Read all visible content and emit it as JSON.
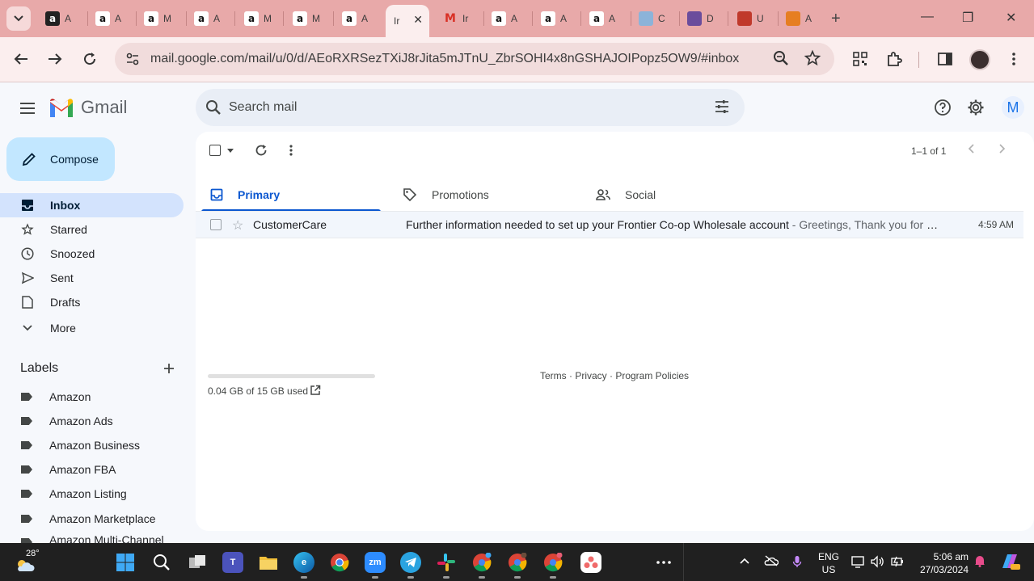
{
  "browser": {
    "tabs": [
      {
        "favicon": "amazon-dark-icon",
        "letter": "a",
        "title": "A"
      },
      {
        "favicon": "amazon-icon",
        "letter": "a",
        "title": "A"
      },
      {
        "favicon": "amazon-icon",
        "letter": "a",
        "title": "M"
      },
      {
        "favicon": "amazon-icon",
        "letter": "a",
        "title": "A"
      },
      {
        "favicon": "amazon-icon",
        "letter": "a",
        "title": "M"
      },
      {
        "favicon": "amazon-icon",
        "letter": "a",
        "title": "M"
      },
      {
        "favicon": "amazon-icon",
        "letter": "a",
        "title": "A"
      },
      {
        "favicon": "gmail-active",
        "letter": "",
        "title": "Ir"
      },
      {
        "favicon": "gmail-icon",
        "letter": "M",
        "title": "Ir"
      },
      {
        "favicon": "amazon-icon",
        "letter": "a",
        "title": "A"
      },
      {
        "favicon": "amazon-icon",
        "letter": "a",
        "title": "A"
      },
      {
        "favicon": "amazon-icon",
        "letter": "a",
        "title": "A"
      },
      {
        "favicon": "site-icon",
        "letter": "",
        "title": "C"
      },
      {
        "favicon": "site-icon",
        "letter": "",
        "title": "D"
      },
      {
        "favicon": "site-icon",
        "letter": "",
        "title": "U"
      },
      {
        "favicon": "site-icon",
        "letter": "",
        "title": "A"
      }
    ],
    "url": "mail.google.com/mail/u/0/d/AEoRXRSezTXiJ8rJita5mJTnU_ZbrSOHI4x8nGSHAJOIPopz5OW9/#inbox",
    "new_tab": "+"
  },
  "gmail": {
    "brand": "Gmail",
    "search_placeholder": "Search mail",
    "avatar_letter": "M",
    "compose": "Compose",
    "nav": [
      {
        "label": "Inbox",
        "icon": "inbox-icon"
      },
      {
        "label": "Starred",
        "icon": "star-icon"
      },
      {
        "label": "Snoozed",
        "icon": "clock-icon"
      },
      {
        "label": "Sent",
        "icon": "send-icon"
      },
      {
        "label": "Drafts",
        "icon": "draft-icon"
      },
      {
        "label": "More",
        "icon": "chevron-down-icon"
      }
    ],
    "labels_title": "Labels",
    "labels": [
      "Amazon",
      "Amazon Ads",
      "Amazon Business",
      "Amazon FBA",
      "Amazon Listing",
      "Amazon Marketplace",
      "Amazon Multi-Channel"
    ],
    "pager": "1–1 of 1",
    "tabs": [
      "Primary",
      "Promotions",
      "Social"
    ],
    "emails": [
      {
        "sender": "CustomerCare",
        "subject": "Further information needed to set up your Frontier Co-op Wholesale account",
        "snippet": " - Greetings, Thank you for your…",
        "time": "4:59 AM"
      }
    ],
    "storage": "0.04 GB of 15 GB used",
    "footer": "Terms · Privacy · Program Policies"
  },
  "taskbar": {
    "temperature": "28°",
    "lang_1": "ENG",
    "lang_2": "US",
    "time": "5:06 am",
    "date": "27/03/2024"
  },
  "colors": {
    "tabstrip": "#e8a9a9",
    "toolbar": "#fbeeee",
    "compose": "#c2e7ff",
    "inbox_active": "#d3e3fd",
    "accent": "#0b57d0"
  }
}
